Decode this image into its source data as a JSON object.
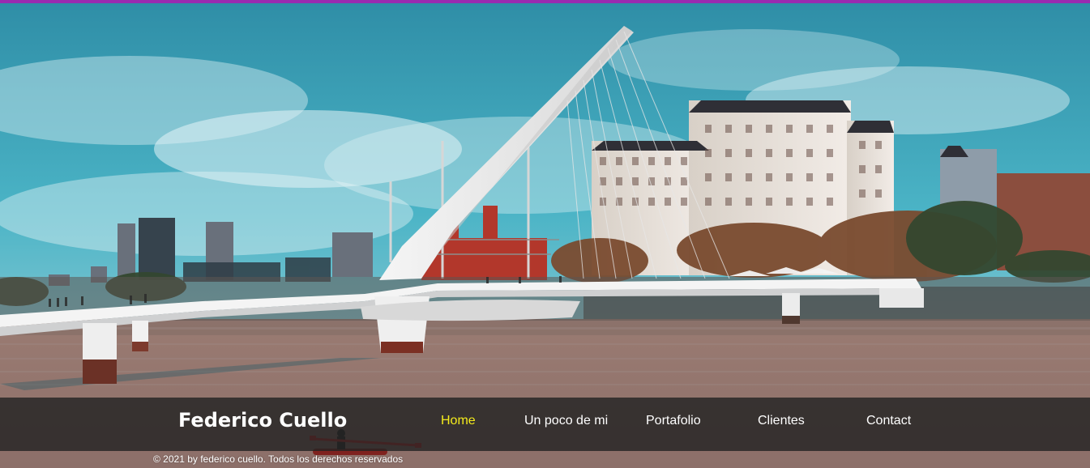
{
  "site": {
    "brand": "Federico Cuello",
    "accent_color": "#9a2bb0",
    "active_nav_color": "#f4eb1c"
  },
  "nav": {
    "items": [
      {
        "label": "Home",
        "active": true
      },
      {
        "label": "Un poco de mi",
        "active": false
      },
      {
        "label": "Portafolio",
        "active": false
      },
      {
        "label": "Clientes",
        "active": false
      },
      {
        "label": "Contact",
        "active": false
      }
    ]
  },
  "footer": {
    "copyright": "© 2021 by federico cuello. Todos los derechos reservados"
  }
}
